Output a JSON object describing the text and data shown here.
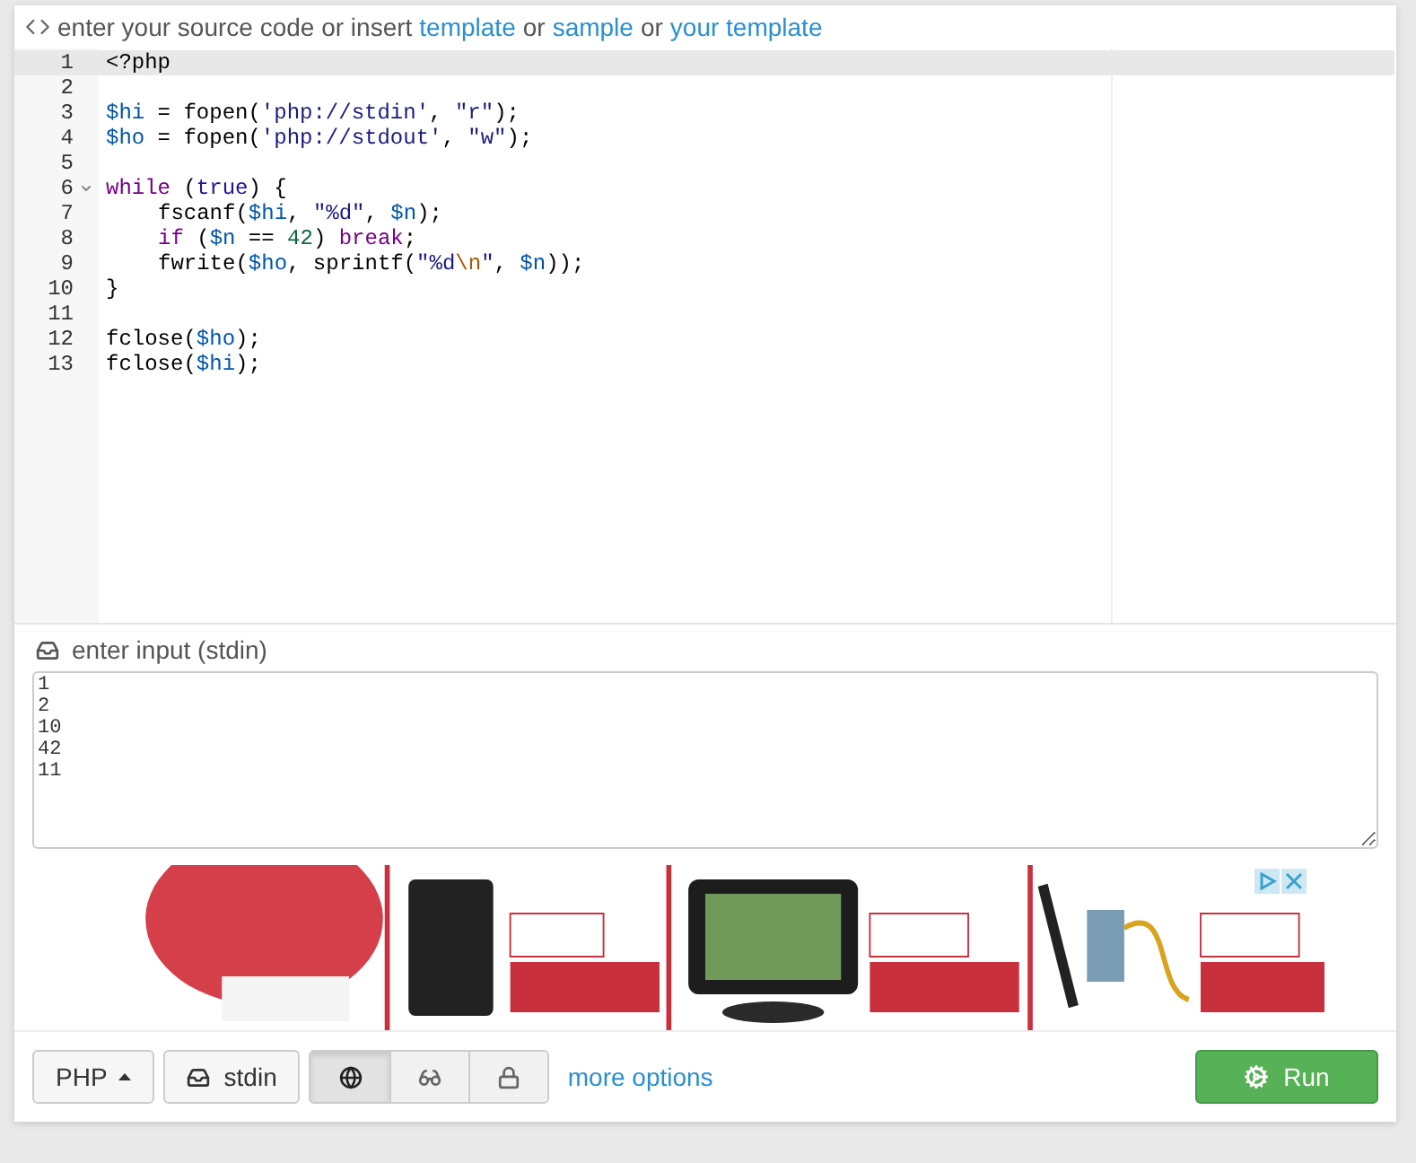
{
  "header": {
    "parts": [
      {
        "text": "enter your source code or insert",
        "link": false
      },
      {
        "text": "template",
        "link": true
      },
      {
        "text": "or",
        "link": false
      },
      {
        "text": "sample",
        "link": true
      },
      {
        "text": "or",
        "link": false
      },
      {
        "text": "your template",
        "link": true
      }
    ]
  },
  "editor": {
    "lines": [
      {
        "number": "1",
        "active": true,
        "foldable": false,
        "indented": false,
        "tokens": [
          {
            "kind": "plain",
            "text": "<?php"
          }
        ]
      },
      {
        "number": "2",
        "active": false,
        "foldable": false,
        "indented": false
      },
      {
        "number": "3",
        "active": false,
        "foldable": false,
        "indented": false,
        "tokens": [
          {
            "kind": "var",
            "text": "$hi"
          },
          {
            "kind": "plain",
            "text": " = fopen("
          },
          {
            "kind": "string",
            "text": "'php://stdin'"
          },
          {
            "kind": "plain",
            "text": ", "
          },
          {
            "kind": "string",
            "text": "\"r\""
          },
          {
            "kind": "plain",
            "text": ");"
          }
        ]
      },
      {
        "number": "4",
        "active": false,
        "foldable": false,
        "indented": false,
        "tokens": [
          {
            "kind": "var",
            "text": "$ho"
          },
          {
            "kind": "plain",
            "text": " = fopen("
          },
          {
            "kind": "string",
            "text": "'php://stdout'"
          },
          {
            "kind": "plain",
            "text": ", "
          },
          {
            "kind": "string",
            "text": "\"w\""
          },
          {
            "kind": "plain",
            "text": ");"
          }
        ]
      },
      {
        "number": "5",
        "active": false,
        "foldable": false,
        "indented": false
      },
      {
        "number": "6",
        "active": false,
        "foldable": true,
        "indented": false,
        "tokens": [
          {
            "kind": "keyword",
            "text": "while"
          },
          {
            "kind": "plain",
            "text": " ("
          },
          {
            "kind": "atom",
            "text": "true"
          },
          {
            "kind": "plain",
            "text": ") {"
          }
        ]
      },
      {
        "number": "7",
        "active": false,
        "foldable": false,
        "indented": true,
        "tokens": [
          {
            "kind": "plain",
            "text": "fscanf("
          },
          {
            "kind": "var",
            "text": "$hi"
          },
          {
            "kind": "plain",
            "text": ", "
          },
          {
            "kind": "string",
            "text": "\"%d\""
          },
          {
            "kind": "plain",
            "text": ", "
          },
          {
            "kind": "var",
            "text": "$n"
          },
          {
            "kind": "plain",
            "text": ");"
          }
        ]
      },
      {
        "number": "8",
        "active": false,
        "foldable": false,
        "indented": true,
        "tokens": [
          {
            "kind": "keyword",
            "text": "if"
          },
          {
            "kind": "plain",
            "text": " ("
          },
          {
            "kind": "var",
            "text": "$n"
          },
          {
            "kind": "plain",
            "text": " == "
          },
          {
            "kind": "number",
            "text": "42"
          },
          {
            "kind": "plain",
            "text": ") "
          },
          {
            "kind": "keyword",
            "text": "break"
          },
          {
            "kind": "plain",
            "text": ";"
          }
        ]
      },
      {
        "number": "9",
        "active": false,
        "foldable": false,
        "indented": true,
        "tokens": [
          {
            "kind": "plain",
            "text": "fwrite("
          },
          {
            "kind": "var",
            "text": "$ho"
          },
          {
            "kind": "plain",
            "text": ", sprintf("
          },
          {
            "kind": "string",
            "text": "\"%d"
          },
          {
            "kind": "escape",
            "text": "\\n"
          },
          {
            "kind": "string",
            "text": "\""
          },
          {
            "kind": "plain",
            "text": ", "
          },
          {
            "kind": "var",
            "text": "$n"
          },
          {
            "kind": "plain",
            "text": "));"
          }
        ]
      },
      {
        "number": "10",
        "active": false,
        "foldable": false,
        "indented": false,
        "tokens": [
          {
            "kind": "plain",
            "text": "}"
          }
        ]
      },
      {
        "number": "11",
        "active": false,
        "foldable": false,
        "indented": false
      },
      {
        "number": "12",
        "active": false,
        "foldable": false,
        "indented": false,
        "tokens": [
          {
            "kind": "plain",
            "text": "fclose("
          },
          {
            "kind": "var",
            "text": "$ho"
          },
          {
            "kind": "plain",
            "text": ");"
          }
        ]
      },
      {
        "number": "13",
        "active": false,
        "foldable": false,
        "indented": false,
        "tokens": [
          {
            "kind": "plain",
            "text": "fclose("
          },
          {
            "kind": "var",
            "text": "$hi"
          },
          {
            "kind": "plain",
            "text": ");"
          }
        ]
      }
    ]
  },
  "stdin": {
    "label": "enter input (stdin)",
    "value": "1\n2\n10\n42\n11"
  },
  "toolbar": {
    "language": "PHP",
    "stdin_button": "stdin",
    "modes": [
      {
        "kind": "public",
        "selected": true
      },
      {
        "kind": "hidden",
        "selected": false
      },
      {
        "kind": "private",
        "selected": false
      }
    ],
    "more_options": "more options",
    "run": "Run"
  }
}
